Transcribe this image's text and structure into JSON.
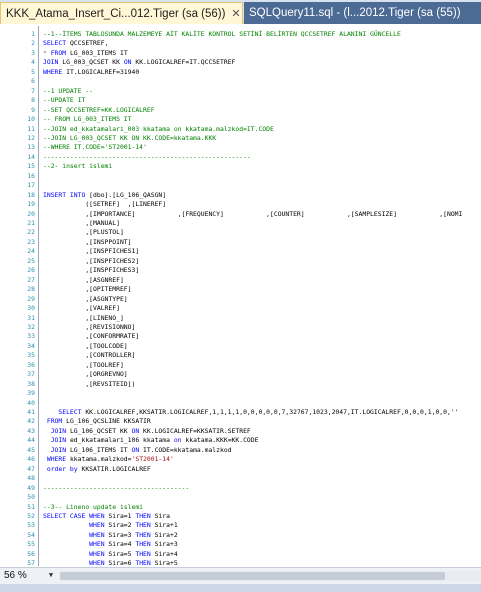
{
  "tabs": {
    "active_label": "KKK_Atama_Insert_Ci...012.Tiger (sa (56))",
    "close_glyph": "✕",
    "inactive_label": "SQLQuery11.sql - (l...2012.Tiger (sa (55))"
  },
  "status": {
    "zoom": "56 %"
  },
  "editor": {
    "lines": [
      {
        "n": "1",
        "segs": [
          [
            "cm",
            "--1--İTEMS TABLOSUNDA MALZEMEYE AİT KALİTE KONTROL SETİNİ BELİRTEN QCCSETREF ALANINI GÜNCELLE"
          ]
        ]
      },
      {
        "n": "2",
        "segs": [
          [
            "kw",
            "SELECT "
          ],
          [
            "id",
            "QCCSETREF,"
          ]
        ]
      },
      {
        "n": "3",
        "segs": [
          [
            "gr",
            "* "
          ],
          [
            "kw",
            "FROM "
          ],
          [
            "id",
            "LG_003_ITEMS IT"
          ]
        ]
      },
      {
        "n": "4",
        "segs": [
          [
            "kw",
            "JOIN "
          ],
          [
            "id",
            "LG_003_QCSET KK "
          ],
          [
            "kw",
            "ON "
          ],
          [
            "id",
            "KK.LOGICALREF=IT.QCCSETREF"
          ]
        ]
      },
      {
        "n": "5",
        "segs": [
          [
            "kw",
            "WHERE "
          ],
          [
            "id",
            "IT.LOGICALREF=31940"
          ]
        ]
      },
      {
        "n": "6",
        "segs": []
      },
      {
        "n": "7",
        "segs": [
          [
            "cm",
            "--1 UPDATE --"
          ]
        ]
      },
      {
        "n": "8",
        "segs": [
          [
            "cm",
            "--UPDATE IT"
          ]
        ]
      },
      {
        "n": "9",
        "segs": [
          [
            "cm",
            "--SET QCCSETREF=KK.LOGICALREF"
          ]
        ]
      },
      {
        "n": "10",
        "segs": [
          [
            "cm",
            "-- FROM LG_003_ITEMS IT"
          ]
        ]
      },
      {
        "n": "11",
        "segs": [
          [
            "cm",
            "--JOIN ed_kkatamalari_003 kkatama on kkatama.malzkod=IT.CODE"
          ]
        ]
      },
      {
        "n": "12",
        "segs": [
          [
            "cm",
            "--JOIN LG_003_QCSET KK ON KK.CODE=kkatama.KKK"
          ]
        ]
      },
      {
        "n": "13",
        "segs": [
          [
            "cm",
            "--WHERE IT.CODE='ST2001-14'"
          ]
        ]
      },
      {
        "n": "14",
        "segs": [
          [
            "cm",
            "------------------------------------------------------"
          ]
        ]
      },
      {
        "n": "15",
        "segs": [
          [
            "cm",
            "--2- insert islemi"
          ]
        ]
      },
      {
        "n": "16",
        "segs": []
      },
      {
        "n": "17",
        "segs": []
      },
      {
        "n": "18",
        "segs": [
          [
            "kw",
            "INSERT INTO "
          ],
          [
            "id",
            "[dbo].[LG_106_QASGN]"
          ]
        ]
      },
      {
        "n": "19",
        "segs": [
          [
            "id",
            "           ([SETREF]  ,[LINEREF]"
          ]
        ]
      },
      {
        "n": "20",
        "segs": [
          [
            "id",
            "           ,[IMPORTANCE]           ,[FREQUENCY]           ,[COUNTER]           ,[SAMPLESIZE]           ,[NOMI"
          ]
        ]
      },
      {
        "n": "21",
        "segs": [
          [
            "id",
            "           ,[MANUAL]"
          ]
        ]
      },
      {
        "n": "22",
        "segs": [
          [
            "id",
            "           ,[PLUSTOL]"
          ]
        ]
      },
      {
        "n": "23",
        "segs": [
          [
            "id",
            "           ,[INSPPOINT]"
          ]
        ]
      },
      {
        "n": "24",
        "segs": [
          [
            "id",
            "           ,[INSPFICHES1]"
          ]
        ]
      },
      {
        "n": "25",
        "segs": [
          [
            "id",
            "           ,[INSPFICHES2]"
          ]
        ]
      },
      {
        "n": "26",
        "segs": [
          [
            "id",
            "           ,[INSPFICHES3]"
          ]
        ]
      },
      {
        "n": "27",
        "segs": [
          [
            "id",
            "           ,[ASGNREF]"
          ]
        ]
      },
      {
        "n": "28",
        "segs": [
          [
            "id",
            "           ,[OPITEMREF]"
          ]
        ]
      },
      {
        "n": "29",
        "segs": [
          [
            "id",
            "           ,[ASGNTYPE]"
          ]
        ]
      },
      {
        "n": "30",
        "segs": [
          [
            "id",
            "           ,[VALREF]"
          ]
        ]
      },
      {
        "n": "31",
        "segs": [
          [
            "id",
            "           ,[LINENO_]"
          ]
        ]
      },
      {
        "n": "32",
        "segs": [
          [
            "id",
            "           ,[REVISIONNO]"
          ]
        ]
      },
      {
        "n": "33",
        "segs": [
          [
            "id",
            "           ,[CONFORMRATE]"
          ]
        ]
      },
      {
        "n": "34",
        "segs": [
          [
            "id",
            "           ,[TOOLCODE]"
          ]
        ]
      },
      {
        "n": "35",
        "segs": [
          [
            "id",
            "           ,[CONTROLLER]"
          ]
        ]
      },
      {
        "n": "36",
        "segs": [
          [
            "id",
            "           ,[TOOLREF]"
          ]
        ]
      },
      {
        "n": "37",
        "segs": [
          [
            "id",
            "           ,[ORGREVNO]"
          ]
        ]
      },
      {
        "n": "38",
        "segs": [
          [
            "id",
            "           ,[REVSITEID])"
          ]
        ]
      },
      {
        "n": "39",
        "segs": []
      },
      {
        "n": "40",
        "segs": []
      },
      {
        "n": "41",
        "segs": [
          [
            "kw",
            "    SELECT "
          ],
          [
            "id",
            "KK.LOGICALREF,KKSATIR.LOGICALREF,1,1,1,1,0,0,0,0,0,7,32767,1023,2047,IT.LOGICALREF,0,0,0,1,0,0,''"
          ]
        ]
      },
      {
        "n": "42",
        "segs": [
          [
            "kw",
            " FROM "
          ],
          [
            "id",
            "LG_106_QCSLINE KKSATIR"
          ]
        ]
      },
      {
        "n": "43",
        "segs": [
          [
            "kw",
            "  JOIN "
          ],
          [
            "id",
            "LG_106_QCSET KK "
          ],
          [
            "kw",
            "ON "
          ],
          [
            "id",
            "KK.LOGICALREF=KKSATIR.SETREF"
          ]
        ]
      },
      {
        "n": "44",
        "segs": [
          [
            "kw",
            "  JOIN "
          ],
          [
            "id",
            "ed_kkatamalari_106 kkatama "
          ],
          [
            "kw",
            "on "
          ],
          [
            "id",
            "kkatama.KKK=KK.CODE"
          ]
        ]
      },
      {
        "n": "45",
        "segs": [
          [
            "kw",
            "  JOIN "
          ],
          [
            "id",
            "LG_106_ITEMS IT "
          ],
          [
            "kw",
            "ON "
          ],
          [
            "id",
            "IT.CODE=kkatama.malzkod"
          ]
        ]
      },
      {
        "n": "46",
        "segs": [
          [
            "kw",
            " WHERE "
          ],
          [
            "id",
            "kkatama.malzkod="
          ],
          [
            "st",
            "'ST2001-14'"
          ]
        ]
      },
      {
        "n": "47",
        "segs": [
          [
            "kw",
            " order by "
          ],
          [
            "id",
            "KKSATIR.LOGICALREF"
          ]
        ]
      },
      {
        "n": "48",
        "segs": []
      },
      {
        "n": "49",
        "segs": [
          [
            "cm",
            "--------------------------------------"
          ]
        ]
      },
      {
        "n": "50",
        "segs": []
      },
      {
        "n": "51",
        "segs": [
          [
            "cm",
            "--3-- Lineno update islemi"
          ]
        ]
      },
      {
        "n": "52",
        "segs": [
          [
            "kw",
            "SELECT CASE WHEN "
          ],
          [
            "id",
            "Sira=1 "
          ],
          [
            "kw",
            "THEN "
          ],
          [
            "id",
            "Sira"
          ]
        ]
      },
      {
        "n": "53",
        "segs": [
          [
            "kw",
            "            WHEN "
          ],
          [
            "id",
            "Sira=2 "
          ],
          [
            "kw",
            "THEN "
          ],
          [
            "id",
            "Sira+1"
          ]
        ]
      },
      {
        "n": "54",
        "segs": [
          [
            "kw",
            "            WHEN "
          ],
          [
            "id",
            "Sira=3 "
          ],
          [
            "kw",
            "THEN "
          ],
          [
            "id",
            "Sira+2"
          ]
        ]
      },
      {
        "n": "55",
        "segs": [
          [
            "kw",
            "            WHEN "
          ],
          [
            "id",
            "Sira=4 "
          ],
          [
            "kw",
            "THEN "
          ],
          [
            "id",
            "Sira+3"
          ]
        ]
      },
      {
        "n": "56",
        "segs": [
          [
            "kw",
            "            WHEN "
          ],
          [
            "id",
            "Sira=5 "
          ],
          [
            "kw",
            "THEN "
          ],
          [
            "id",
            "Sira+4"
          ]
        ]
      },
      {
        "n": "57",
        "segs": [
          [
            "kw",
            "            WHEN "
          ],
          [
            "id",
            "Sira=6 "
          ],
          [
            "kw",
            "THEN "
          ],
          [
            "id",
            "Sira+5"
          ]
        ]
      }
    ]
  }
}
